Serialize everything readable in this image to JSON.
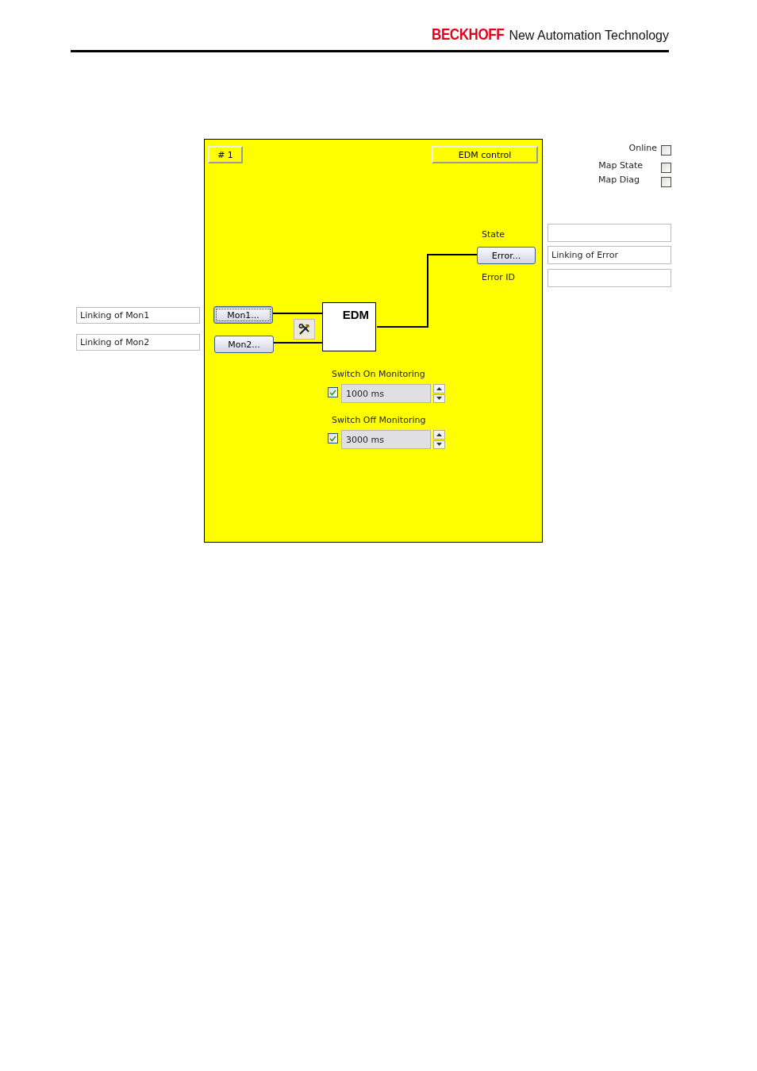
{
  "header": {
    "brand": "BECKHOFF",
    "tagline": "New Automation Technology"
  },
  "left_links": [
    {
      "value": "Linking of Mon1"
    },
    {
      "value": "Linking of Mon2"
    }
  ],
  "canvas": {
    "number_button": "# 1",
    "title_button": "EDM control",
    "state_label": "State",
    "error_button": "Error...",
    "error_id_label": "Error ID",
    "block": "EDM",
    "inputs": [
      {
        "label": "Mon1...",
        "focused": true
      },
      {
        "label": "Mon2...",
        "focused": false
      }
    ],
    "monitors": [
      {
        "label": "Switch On Monitoring",
        "checked": true,
        "value": "1000 ms"
      },
      {
        "label": "Switch Off Monitoring",
        "checked": true,
        "value": "3000 ms"
      }
    ]
  },
  "options": [
    {
      "label": "Online",
      "checked": false
    },
    {
      "label": "Map State",
      "checked": false
    },
    {
      "label": "Map Diag",
      "checked": false
    }
  ],
  "error_link": "Linking of Error"
}
